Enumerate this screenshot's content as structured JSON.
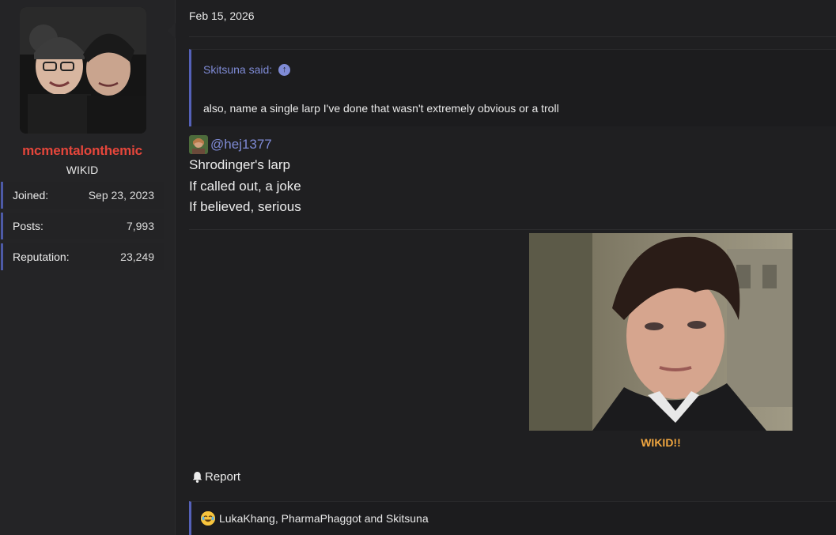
{
  "user": {
    "name": "mcmentalonthemic",
    "title": "WIKID",
    "stats": [
      {
        "label": "Joined:",
        "value": "Sep 23, 2023"
      },
      {
        "label": "Posts:",
        "value": "7,993"
      },
      {
        "label": "Reputation:",
        "value": "23,249"
      }
    ]
  },
  "post": {
    "date": "Feb 15, 2026",
    "quote": {
      "author": "Skitsuna said:",
      "text": "also, name a single larp I've done that wasn't extremely obvious or a troll"
    },
    "mention": "@hej1377",
    "lines": [
      "Shrodinger's larp",
      "If called out, a joke",
      "If believed, serious"
    ],
    "image_caption": "WIKID!!",
    "report_label": "Report",
    "reactions": "LukaKhang, PharmaPhaggot and Skitsuna"
  },
  "colors": {
    "username": "#e5463b",
    "accent": "#5561b8",
    "link": "#7f8bd6",
    "caption": "#f0a640"
  }
}
